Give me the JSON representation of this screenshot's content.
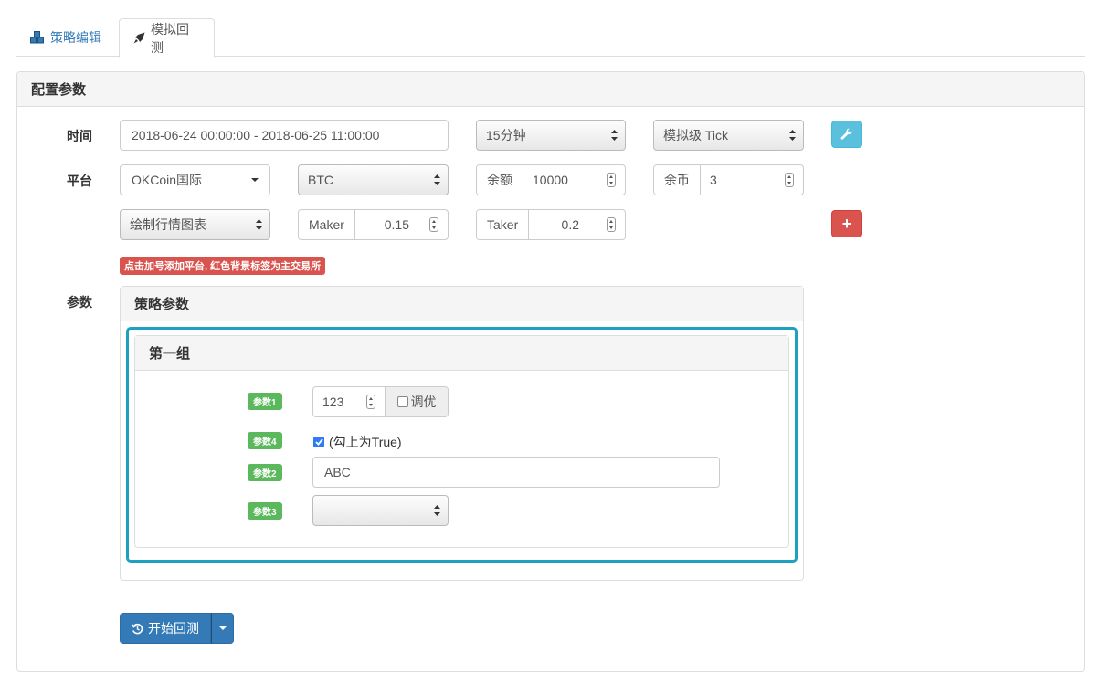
{
  "tabs": [
    {
      "label": "策略编辑",
      "icon": "cubes-icon"
    },
    {
      "label": "模拟回测",
      "icon": "rocket-icon"
    }
  ],
  "panel": {
    "title": "配置参数"
  },
  "rows": {
    "time_label": "时间",
    "platform_label": "平台",
    "params_label": "参数"
  },
  "time": {
    "range": "2018-06-24 00:00:00 - 2018-06-25 11:00:00",
    "period": "15分钟",
    "mode": "模拟级 Tick"
  },
  "platform": {
    "exchange": "OKCoin国际",
    "currency": "BTC",
    "balance_label": "余额",
    "balance": "10000",
    "coins_label": "余币",
    "coins": "3",
    "chart_option": "绘制行情图表",
    "maker_label": "Maker",
    "maker": "0.15",
    "taker_label": "Taker",
    "taker": "0.2",
    "hint": "点击加号添加平台, 红色背景标签为主交易所",
    "add_symbol": "+"
  },
  "strategy": {
    "title": "策略参数",
    "group_title": "第一组",
    "params": {
      "p1_label": "参数1",
      "p1_value": "123",
      "p1_tune": "调优",
      "p4_label": "参数4",
      "p4_text": "(勾上为True)",
      "p4_checked": true,
      "p2_label": "参数2",
      "p2_value": "ABC",
      "p3_label": "参数3",
      "p3_value": ""
    }
  },
  "actions": {
    "start_label": "开始回测"
  },
  "colors": {
    "primary": "#337ab7",
    "info": "#5bc0de",
    "danger": "#d9534f",
    "success": "#5cb85c",
    "highlight": "#1ea0c0"
  }
}
